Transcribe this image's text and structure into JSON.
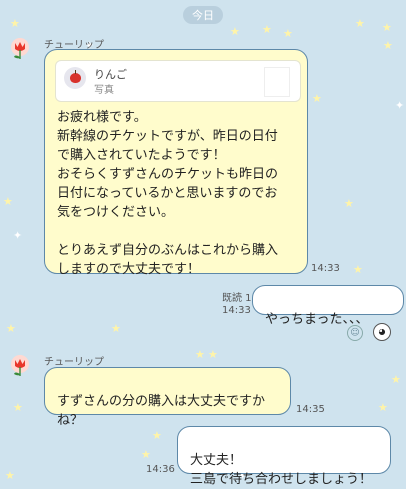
{
  "date_separator": "今日",
  "messages": [
    {
      "sender": "チューリップ",
      "reply_to": {
        "name": "りんご",
        "type": "写真"
      },
      "text": "お疲れ様です。\n新幹線のチケットですが、昨日の日付\nで購入されていたようです！\nおそらくすずさんのチケットも昨日の\n日付になっているかと思いますのでお\n気をつけください。\n\nとりあえず自分のぶんはこれから購入\nしますので大丈夫です！",
      "time": "14:33"
    },
    {
      "sender": "me",
      "read_status": "既読 1",
      "time": "14:33",
      "text": "やっちまった、、、"
    },
    {
      "sender": "チューリップ",
      "text": "すずさんの分の購入は大丈夫ですか\nね？",
      "time": "14:35"
    },
    {
      "sender": "me",
      "time": "14:36",
      "text": "大丈夫！\n三島で待ち合わせしましょう！"
    }
  ],
  "colors": {
    "background": "#cfe3ee",
    "incoming_bubble": "#fffccc",
    "outgoing_bubble": "#ffffff",
    "bubble_border": "#5d88a8"
  },
  "icons": [
    "tulip-avatar-icon",
    "apple-icon",
    "smiley-reaction-icon",
    "sticker-icon"
  ]
}
